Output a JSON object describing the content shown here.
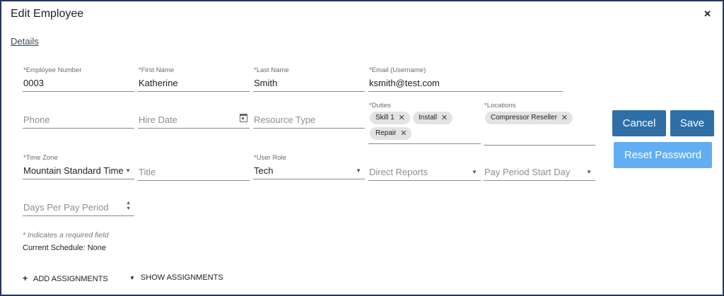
{
  "dialog": {
    "title": "Edit Employee",
    "close_symbol": "✕",
    "details_link": "Details"
  },
  "fields": {
    "employee_number": {
      "label": "*Employee Number",
      "value": "0003"
    },
    "first_name": {
      "label": "*First Name",
      "value": "Katherine"
    },
    "last_name": {
      "label": "*Last Name",
      "value": "Smith"
    },
    "email": {
      "label": "*Email (Username)",
      "value": "ksmith@test.com"
    },
    "phone": {
      "placeholder": "Phone"
    },
    "hire_date": {
      "placeholder": "Hire Date"
    },
    "resource_type": {
      "placeholder": "Resource Type"
    },
    "duties": {
      "label": "*Duties",
      "chips": [
        "Skill 1",
        "Install",
        "Repair"
      ]
    },
    "locations": {
      "label": "*Locations",
      "chips": [
        "Compressor Reseller"
      ]
    },
    "time_zone": {
      "label": "*Time Zone",
      "value": "Mountain Standard Time"
    },
    "title": {
      "placeholder": "Title"
    },
    "user_role": {
      "label": "*User Role",
      "value": "Tech"
    },
    "direct_reports": {
      "placeholder": "Direct Reports"
    },
    "pay_period_start_day": {
      "placeholder": "Pay Period Start Day"
    },
    "days_per_pay_period": {
      "placeholder": "Days Per Pay Period"
    }
  },
  "buttons": {
    "cancel": "Cancel",
    "save": "Save",
    "reset_password": "Reset Password"
  },
  "footer": {
    "required_note": "* Indicates a required field",
    "current_schedule": "Current Schedule: None",
    "add_assignments": "ADD ASSIGNMENTS",
    "show_assignments": "SHOW ASSIGNMENTS"
  },
  "icons": {
    "dropdown": "▼",
    "chip_remove": "✕",
    "add": "+",
    "stepper_up": "▲",
    "stepper_down": "▼"
  },
  "colors": {
    "border": "#27365a",
    "primary_button": "#2f6fa8",
    "light_button": "#63aef2",
    "chip_bg": "#e3e3e3"
  }
}
